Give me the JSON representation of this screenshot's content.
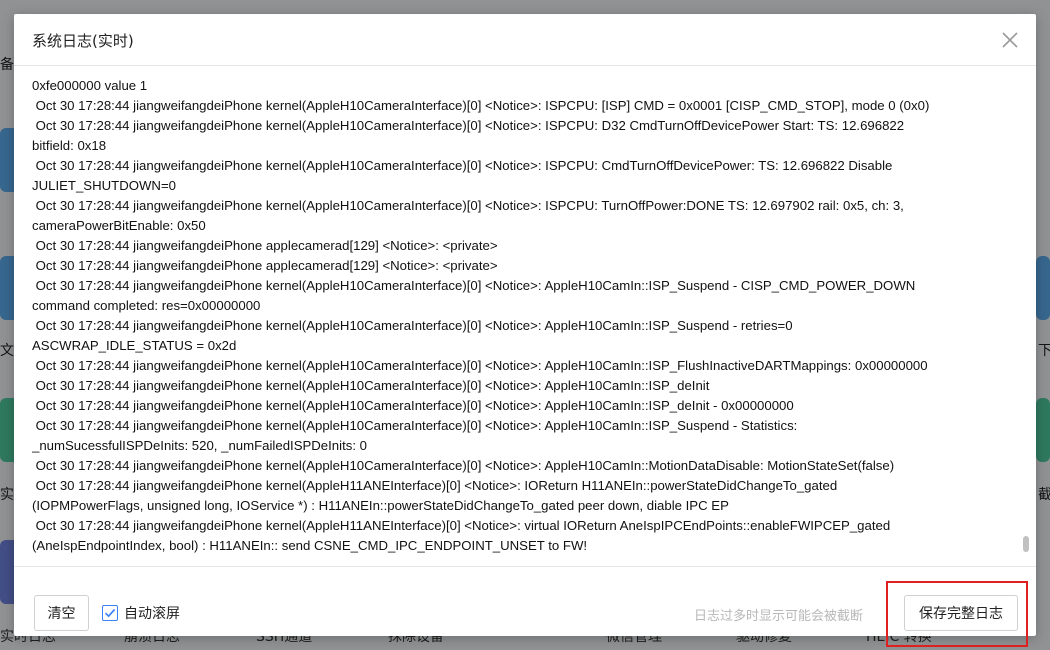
{
  "background": {
    "bottom_labels": [
      "实时日志",
      "崩溃日志",
      "SSH通道",
      "抹除设备",
      "微信管理",
      "驱动修复",
      "HEIC 转换"
    ],
    "side_labels_left": [
      "备",
      "文件",
      "实时"
    ],
    "side_labels_right": [
      "下载",
      "截图"
    ]
  },
  "dialog": {
    "title": "系统日志(实时)",
    "close_icon": "close-icon"
  },
  "log": {
    "lines": [
      "0xfe000000 value 1",
      " Oct 30 17:28:44 jiangweifangdeiPhone kernel(AppleH10CameraInterface)[0] <Notice>: ISPCPU: [ISP] CMD = 0x0001 [CISP_CMD_STOP], mode 0 (0x0)",
      " Oct 30 17:28:44 jiangweifangdeiPhone kernel(AppleH10CameraInterface)[0] <Notice>: ISPCPU: D32 CmdTurnOffDevicePower Start: TS: 12.696822\nbitfield: 0x18",
      " Oct 30 17:28:44 jiangweifangdeiPhone kernel(AppleH10CameraInterface)[0] <Notice>: ISPCPU: CmdTurnOffDevicePower: TS: 12.696822 Disable\nJULIET_SHUTDOWN=0",
      " Oct 30 17:28:44 jiangweifangdeiPhone kernel(AppleH10CameraInterface)[0] <Notice>: ISPCPU: TurnOffPower:DONE TS: 12.697902 rail: 0x5, ch: 3,\ncameraPowerBitEnable: 0x50",
      " Oct 30 17:28:44 jiangweifangdeiPhone applecamerad[129] <Notice>: <private>",
      " Oct 30 17:28:44 jiangweifangdeiPhone applecamerad[129] <Notice>: <private>",
      " Oct 30 17:28:44 jiangweifangdeiPhone kernel(AppleH10CameraInterface)[0] <Notice>: AppleH10CamIn::ISP_Suspend - CISP_CMD_POWER_DOWN\ncommand completed: res=0x00000000",
      " Oct 30 17:28:44 jiangweifangdeiPhone kernel(AppleH10CameraInterface)[0] <Notice>: AppleH10CamIn::ISP_Suspend - retries=0\nASCWRAP_IDLE_STATUS = 0x2d",
      " Oct 30 17:28:44 jiangweifangdeiPhone kernel(AppleH10CameraInterface)[0] <Notice>: AppleH10CamIn::ISP_FlushInactiveDARTMappings: 0x00000000",
      " Oct 30 17:28:44 jiangweifangdeiPhone kernel(AppleH10CameraInterface)[0] <Notice>: AppleH10CamIn::ISP_deInit",
      " Oct 30 17:28:44 jiangweifangdeiPhone kernel(AppleH10CameraInterface)[0] <Notice>: AppleH10CamIn::ISP_deInit - 0x00000000",
      " Oct 30 17:28:44 jiangweifangdeiPhone kernel(AppleH10CameraInterface)[0] <Notice>: AppleH10CamIn::ISP_Suspend - Statistics:\n_numSucessfulISPDeInits: 520, _numFailedISPDeInits: 0",
      " Oct 30 17:28:44 jiangweifangdeiPhone kernel(AppleH10CameraInterface)[0] <Notice>: AppleH10CamIn::MotionDataDisable: MotionStateSet(false)",
      " Oct 30 17:28:44 jiangweifangdeiPhone kernel(AppleH11ANEInterface)[0] <Notice>: IOReturn H11ANEIn::powerStateDidChangeTo_gated\n(IOPMPowerFlags, unsigned long, IOService *) : H11ANEIn::powerStateDidChangeTo_gated peer down, diable IPC EP",
      " Oct 30 17:28:44 jiangweifangdeiPhone kernel(AppleH11ANEInterface)[0] <Notice>: virtual IOReturn AneIspIPCEndPoints::enableFWIPCEP_gated\n(AneIspEndpointIndex, bool) : H11ANEIn:: send CSNE_CMD_IPC_ENDPOINT_UNSET to FW!"
    ]
  },
  "footer": {
    "clear_label": "清空",
    "autoscroll_label": "自动滚屏",
    "autoscroll_checked": true,
    "hint_text": "日志过多时显示可能会被截断",
    "save_label": "保存完整日志"
  },
  "colors": {
    "highlight": "#e02020",
    "checkbox_accent": "#3b82f6"
  }
}
